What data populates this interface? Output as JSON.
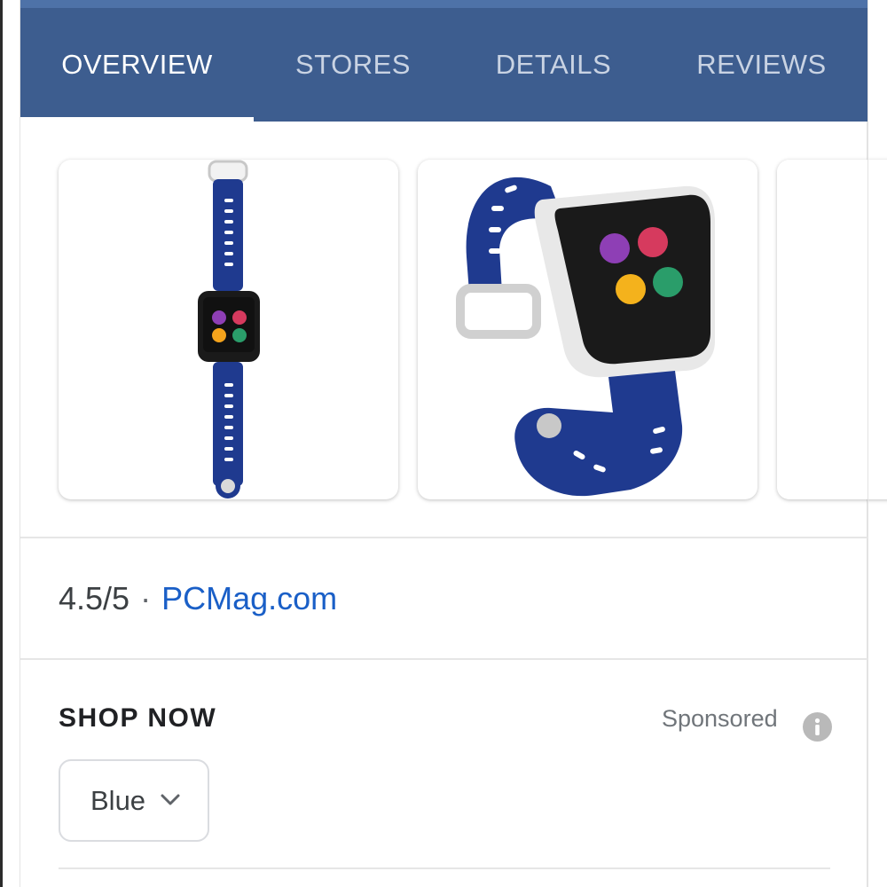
{
  "tabs": [
    {
      "label": "OVERVIEW",
      "active": true
    },
    {
      "label": "STORES",
      "active": false
    },
    {
      "label": "DETAILS",
      "active": false
    },
    {
      "label": "REVIEWS",
      "active": false
    }
  ],
  "gallery": {
    "images": [
      {
        "icon": "watch-front-image"
      },
      {
        "icon": "watch-angled-image"
      },
      {
        "icon": "watch-partial-image"
      }
    ]
  },
  "rating": {
    "score": "4.5/5",
    "separator": "·",
    "source": "PCMag.com"
  },
  "shop": {
    "title": "SHOP NOW",
    "sponsored": "Sponsored",
    "info_icon": "info-icon",
    "variant": "Blue"
  },
  "colors": {
    "tab_bar": "#3d5d8f",
    "link": "#1a5fc7",
    "strap_blue": "#1f3a8f"
  }
}
